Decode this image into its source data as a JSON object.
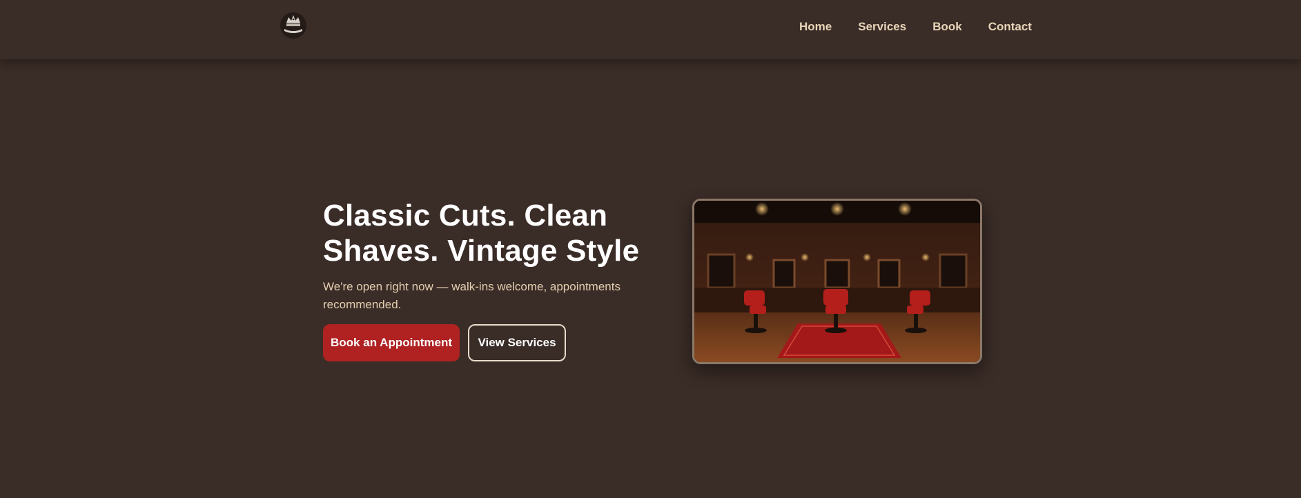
{
  "brand": {
    "logo_icon": "crown-emblem-icon"
  },
  "nav": {
    "items": [
      "Home",
      "Services",
      "Book",
      "Contact"
    ]
  },
  "hero": {
    "title": "Classic Cuts. Clean Shaves. Vintage Style",
    "subtitle": "We're open right now — walk-ins welcome, appointments recommended.",
    "primary_button": "Book an Appointment",
    "secondary_button": "View Services",
    "image_icon": "barbershop-interior-photo"
  },
  "colors": {
    "background": "#3a2c27",
    "accent": "#b02222",
    "nav_text": "#e8d6b9",
    "subtitle_text": "#e3cfb0"
  }
}
